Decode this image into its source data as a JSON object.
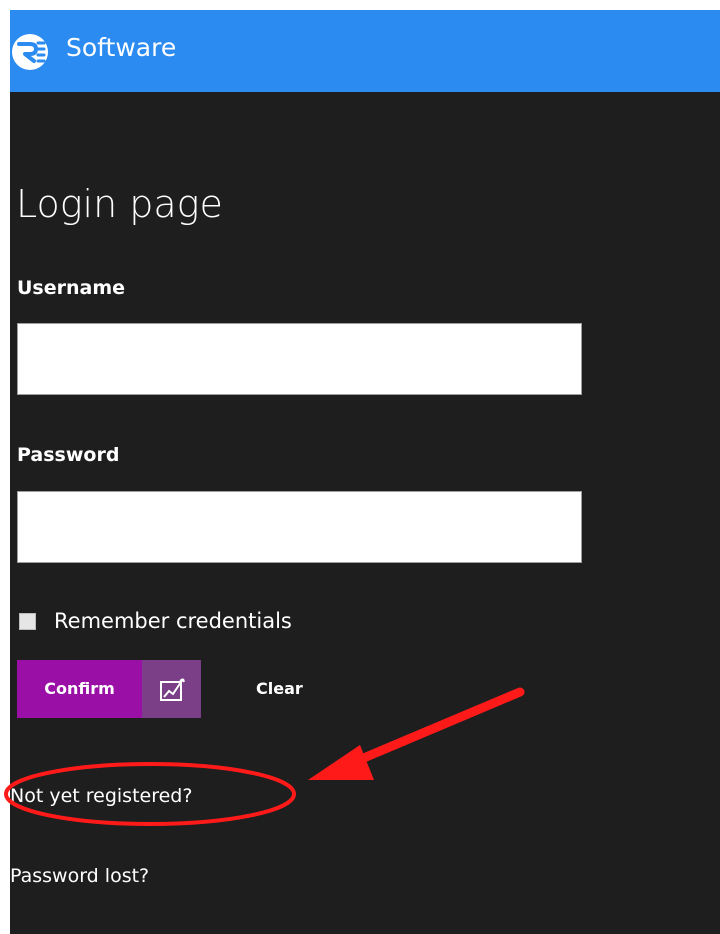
{
  "header": {
    "app_title": "Software",
    "logo_icon": "logo-badge-icon",
    "background_color": "#2b8bf0"
  },
  "login": {
    "page_title": "Login page",
    "username_label": "Username",
    "username_value": "",
    "password_label": "Password",
    "password_value": "",
    "remember_label": "Remember credentials",
    "remember_checked": false,
    "confirm_label": "Confirm",
    "confirm_icon": "confirm-chart-icon",
    "clear_label": "Clear",
    "register_link": "Not yet registered?",
    "password_lost_link": "Password lost?"
  },
  "colors": {
    "page_background": "#1e1e1e",
    "confirm_primary": "#9a0fa6",
    "confirm_icon_background": "#7a3f86",
    "annotation": "#ff1a1a"
  },
  "annotation": {
    "target": "register-link",
    "arrow_icon": "red-arrow-icon",
    "highlight": "red-ellipse-icon"
  }
}
